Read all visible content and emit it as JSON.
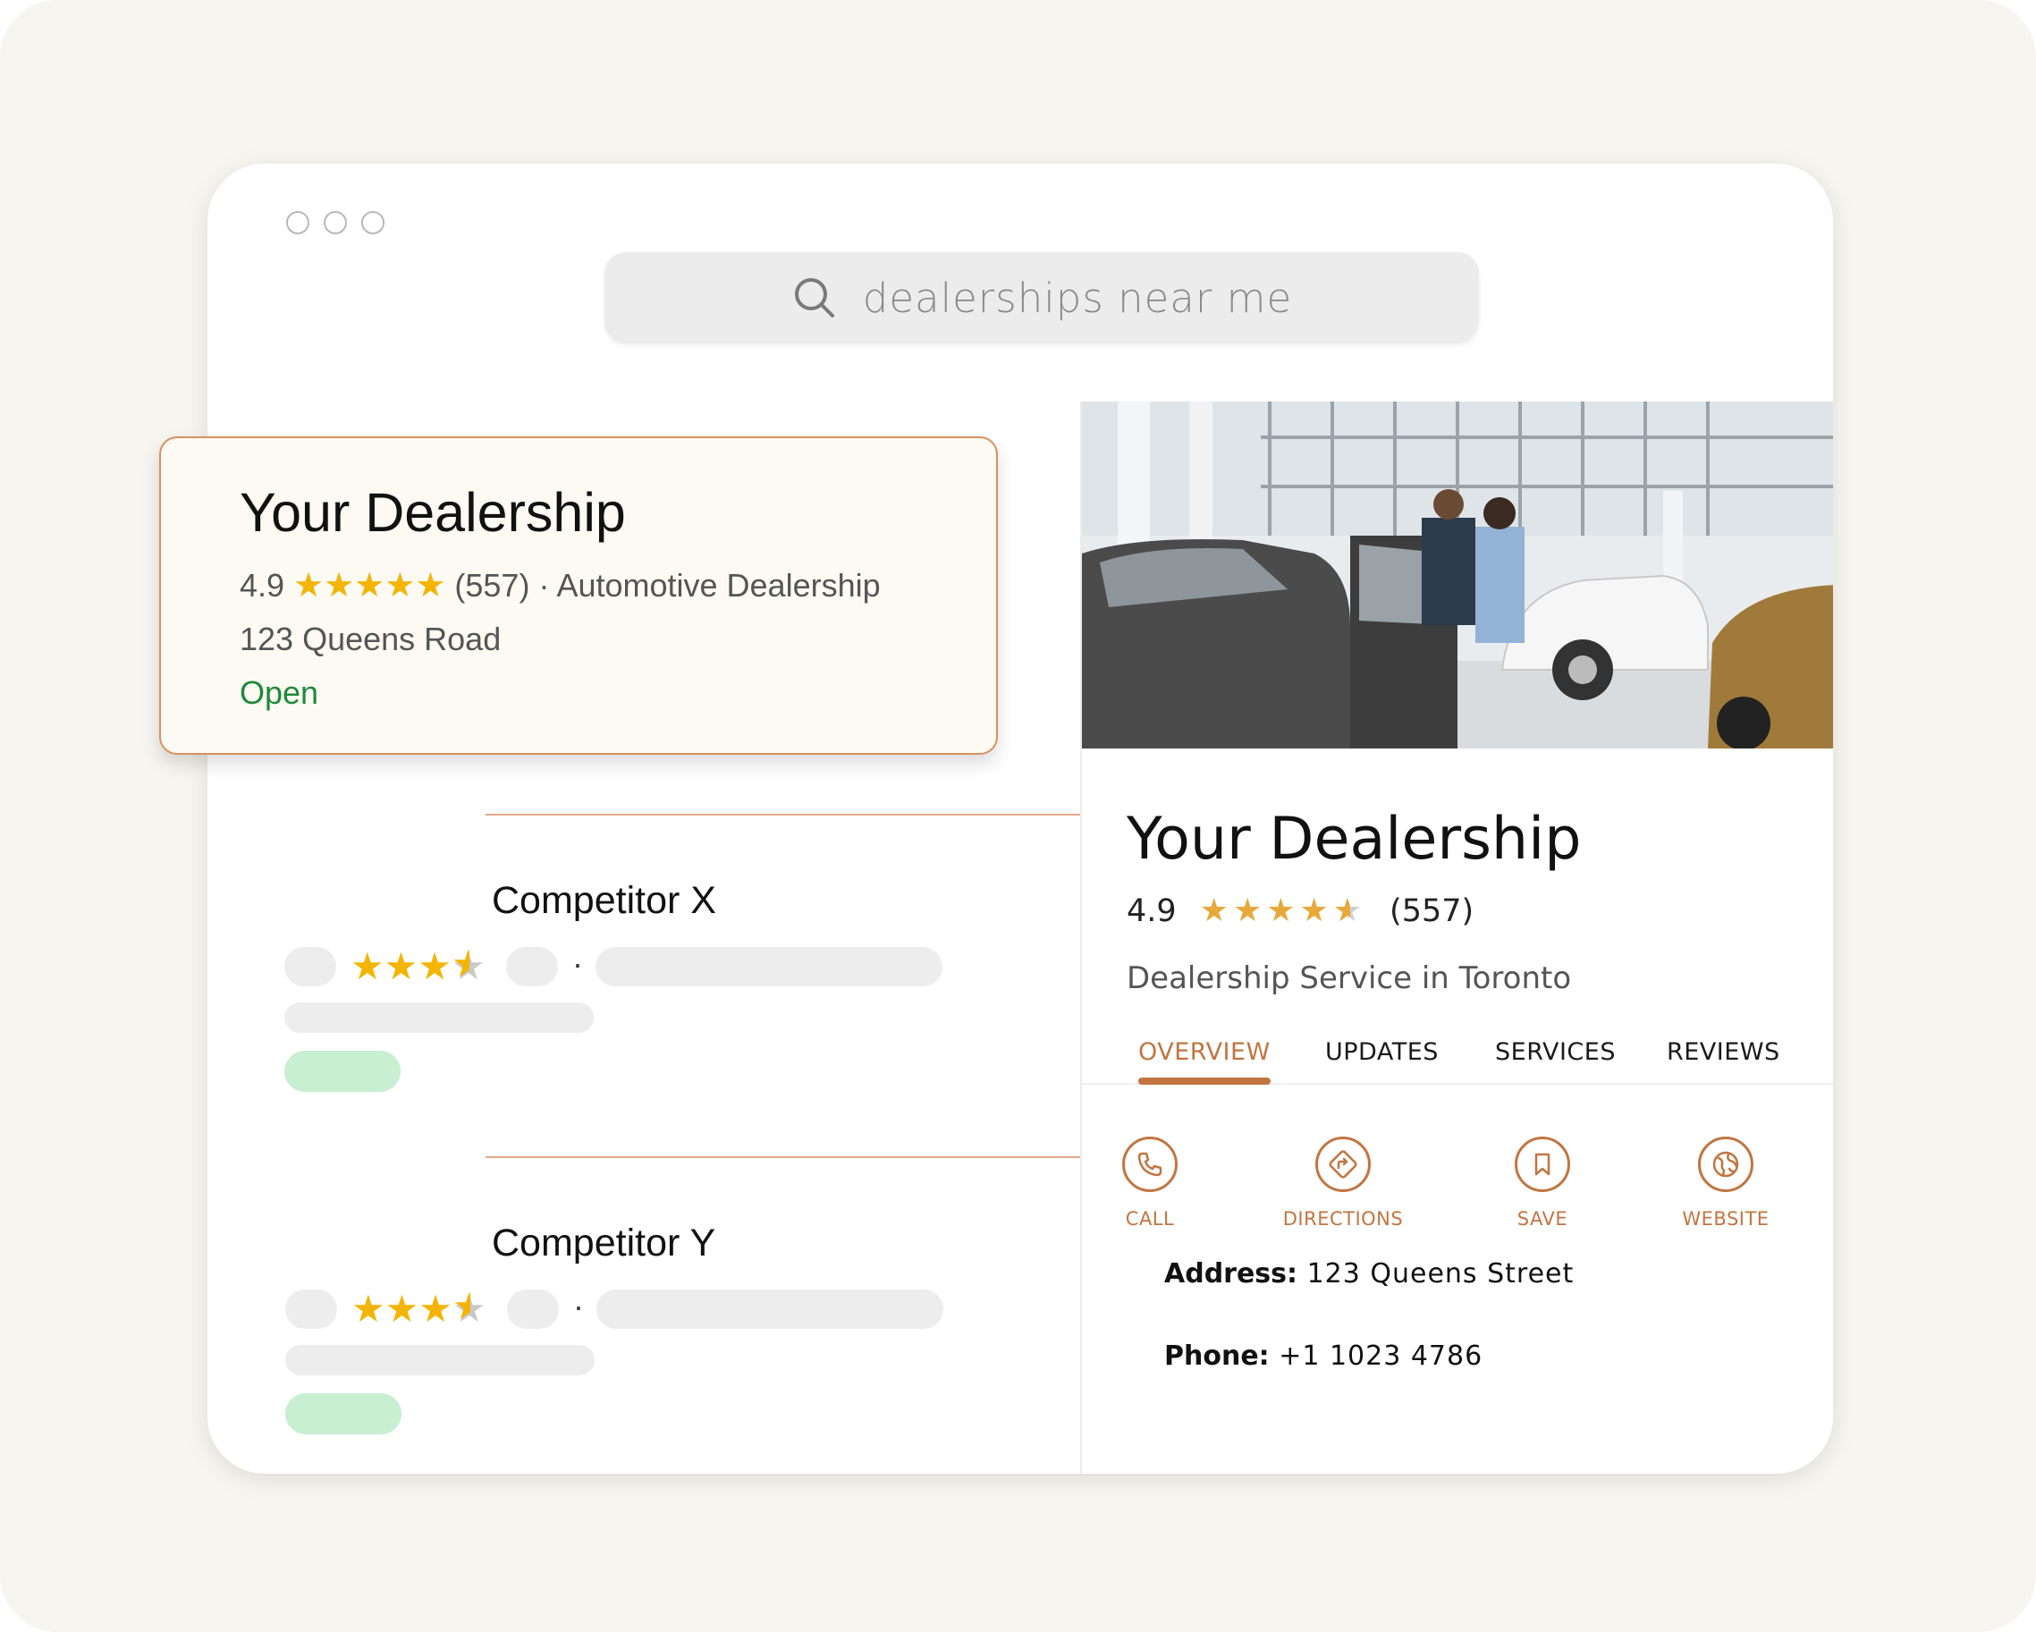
{
  "search": {
    "query": "dealerships near me"
  },
  "featured": {
    "name": "Your Dealership",
    "rating": "4.9",
    "stars": "★★★★★",
    "count": "(557)",
    "category": "· Automotive Dealership",
    "address": "123 Queens Road",
    "status": "Open"
  },
  "competitors": [
    {
      "name": "Competitor X",
      "stars": "★★★"
    },
    {
      "name": "Competitor Y",
      "stars": "★★★"
    }
  ],
  "details": {
    "title": "Your Dealership",
    "rating": "4.9",
    "stars": "★★★★",
    "count": "(557)",
    "category": "Dealership Service in Toronto",
    "tabs": [
      "OVERVIEW",
      "UPDATES",
      "SERVICES",
      "REVIEWS"
    ],
    "actions": [
      "CALL",
      "DIRECTIONS",
      "SAVE",
      "WEBSITE"
    ],
    "address_label": "Address:",
    "address_value": "123 Queens Street",
    "phone_label": "Phone:",
    "phone_value": "+1 1023 4786"
  },
  "colors": {
    "accent": "#c27541",
    "star": "#f4b400",
    "open": "#1e8a3a",
    "background": "#f6f5ef"
  }
}
